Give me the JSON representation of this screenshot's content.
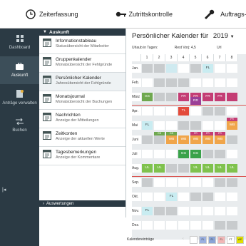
{
  "topbar": {
    "items": [
      {
        "label": "Zeiterfassung",
        "icon": "clock-icon"
      },
      {
        "label": "Zutrittskontrolle",
        "icon": "key-icon"
      },
      {
        "label": "Auftrags-/",
        "icon": "wrench-icon"
      }
    ]
  },
  "rail": {
    "items": [
      {
        "label": "Dashboard",
        "icon": "dashboard-icon"
      },
      {
        "label": "Auskunft",
        "icon": "briefcase-icon",
        "active": true
      },
      {
        "label": "Anträge verwalten",
        "icon": "document-icon"
      },
      {
        "label": "Buchen",
        "icon": "swap-icon"
      }
    ],
    "collapse_glyph": "|◂"
  },
  "menu": {
    "header": "Auskunft",
    "items": [
      {
        "title": "Informationstableau",
        "sub": "Statusübersicht der Mitarbeiter",
        "icon": "table-icon"
      },
      {
        "title": "Gruppenkalender",
        "sub": "Monatsübersicht der Fehlgründe",
        "icon": "calendar-grid-icon"
      },
      {
        "title": "Persönlicher Kalender",
        "sub": "Jahresübersicht der Fehlgründe",
        "icon": "calendar-year-icon",
        "selected": true
      },
      {
        "title": "Monatsjournal",
        "sub": "Monatsübersicht der Buchungen",
        "icon": "journal-icon"
      },
      {
        "title": "Nachrichten",
        "sub": "Anzeige der Mitteilungen",
        "icon": "message-icon"
      },
      {
        "title": "Zeitkonten",
        "sub": "Anzeige der aktuellen Werte",
        "icon": "clock-account-icon"
      },
      {
        "title": "Tagesbemerkungen",
        "sub": "Anzeige der Kommentare",
        "icon": "notes-icon"
      }
    ],
    "footer": "Auswertungen"
  },
  "calendar": {
    "title": "Persönlicher Kalender für",
    "year": "2019",
    "info_left": "Urlaub in Tagen:",
    "info_mid": "Rest Vorj: 4,5",
    "info_right": "Url",
    "days": [
      "1",
      "2",
      "3",
      "4",
      "5",
      "6",
      "7",
      "8"
    ],
    "months": [
      "Jan.",
      "Feb.",
      "März",
      "Apr.",
      "Mai",
      "Juni",
      "Juli",
      "Aug.",
      "Sep.",
      "Okt.",
      "Nov.",
      "Dez."
    ],
    "legend_label": "Kalendereinträge",
    "legend_swatches": [
      {
        "label": "",
        "color": "#ffffff"
      },
      {
        "label": "FL",
        "color": "#9bb0e0"
      },
      {
        "label": "FL",
        "color": "#8aa4d6"
      },
      {
        "label": "FL",
        "color": "#f2b7b7"
      },
      {
        "label": "FT",
        "color": "#ffffff"
      },
      {
        "label": "WE",
        "color": "#e0e000"
      }
    ],
    "cells": [
      {
        "m": 0,
        "d": 1,
        "t": "",
        "c": "#c8cbcd"
      },
      {
        "m": 0,
        "d": 2,
        "t": "",
        "c": "#c8cbcd"
      },
      {
        "m": 0,
        "d": 3,
        "t": "",
        "c": "#cfeaf0"
      },
      {
        "m": 0,
        "d": 6,
        "t": "FL",
        "c": "#c9ecf1"
      },
      {
        "m": 1,
        "d": 3,
        "t": "",
        "c": "#c8cbcd"
      },
      {
        "m": 1,
        "d": 4,
        "t": "",
        "c": "#c8cbcd"
      },
      {
        "m": 2,
        "d": 1,
        "t": "GS",
        "c": "#6fa84f"
      },
      {
        "m": 2,
        "d": 4,
        "t": "FR",
        "c": "#c43d74"
      },
      {
        "m": 2,
        "d": 5,
        "t": "FR",
        "c": "#c43d74"
      },
      {
        "m": 2,
        "d": 6,
        "t": "FR",
        "c": "#c43d74"
      },
      {
        "m": 2,
        "d": 7,
        "t": "FR",
        "c": "#c43d74"
      },
      {
        "m": 2,
        "d": 8,
        "t": "",
        "c": "#c43d74"
      },
      {
        "m": 2,
        "d": 5,
        "t": "RR",
        "c": "#9b3f97",
        "row2": true
      },
      {
        "m": 3,
        "d": 4,
        "t": "TL",
        "c": "#e34b3b"
      },
      {
        "m": 3,
        "d": 6,
        "t": "",
        "c": "#c8cbcd"
      },
      {
        "m": 4,
        "d": 1,
        "t": "FL",
        "c": "#c9ecf1"
      },
      {
        "m": 4,
        "d": 8,
        "t": "FR",
        "c": "#c43d74",
        "half": true
      },
      {
        "m": 4,
        "d": 8,
        "t": "WB",
        "c": "#f0a54a"
      },
      {
        "m": 5,
        "d": 2,
        "t": "GS",
        "c": "#6fa84f",
        "half": true
      },
      {
        "m": 5,
        "d": 3,
        "t": "GS",
        "c": "#6fa84f",
        "half": true
      },
      {
        "m": 5,
        "d": 5,
        "t": "FR",
        "c": "#c43d74",
        "half": true
      },
      {
        "m": 5,
        "d": 6,
        "t": "FR",
        "c": "#c43d74",
        "half": true
      },
      {
        "m": 5,
        "d": 7,
        "t": "FR",
        "c": "#c43d74",
        "half": true
      },
      {
        "m": 5,
        "d": 3,
        "t": "WB",
        "c": "#f0a54a"
      },
      {
        "m": 5,
        "d": 4,
        "t": "WB",
        "c": "#f0a54a"
      },
      {
        "m": 5,
        "d": 5,
        "t": "WB",
        "c": "#f0a54a"
      },
      {
        "m": 5,
        "d": 6,
        "t": "WB",
        "c": "#f0a54a"
      },
      {
        "m": 5,
        "d": 7,
        "t": "WB",
        "c": "#f0a54a"
      },
      {
        "m": 6,
        "d": 4,
        "t": "GG",
        "c": "#3aa24a"
      },
      {
        "m": 6,
        "d": 5,
        "t": "GG",
        "c": "#3aa24a"
      },
      {
        "m": 7,
        "d": 1,
        "t": "UL",
        "c": "#7fc24d"
      },
      {
        "m": 7,
        "d": 2,
        "t": "UL",
        "c": "#7fc24d"
      },
      {
        "m": 7,
        "d": 5,
        "t": "UL",
        "c": "#7fc24d"
      },
      {
        "m": 7,
        "d": 6,
        "t": "UL",
        "c": "#7fc24d"
      },
      {
        "m": 7,
        "d": 7,
        "t": "UL",
        "c": "#7fc24d"
      },
      {
        "m": 7,
        "d": 8,
        "t": "UL",
        "c": "#7fc24d"
      },
      {
        "m": 8,
        "d": 1,
        "t": "",
        "c": "#c8cbcd"
      },
      {
        "m": 8,
        "d": 7,
        "t": "",
        "c": "#c8cbcd"
      },
      {
        "m": 9,
        "d": 3,
        "t": "FL",
        "c": "#c9ecf1"
      },
      {
        "m": 9,
        "d": 5,
        "t": "",
        "c": "#c8cbcd"
      },
      {
        "m": 10,
        "d": 1,
        "t": "FL",
        "c": "#c9ecf1"
      },
      {
        "m": 10,
        "d": 2,
        "t": "",
        "c": "#c8cbcd"
      },
      {
        "m": 10,
        "d": 3,
        "t": "",
        "c": "#c8cbcd"
      },
      {
        "m": 11,
        "d": 7,
        "t": "",
        "c": "#c8cbcd"
      }
    ],
    "weekend_cols": [
      [
        5,
        6
      ],
      [
        2,
        3
      ],
      [
        2,
        3
      ],
      [
        6,
        7
      ],
      [
        4,
        5
      ],
      [
        1,
        2,
        8
      ],
      [
        6,
        7
      ],
      [
        3,
        4
      ],
      [
        7,
        8
      ],
      [
        5,
        6
      ],
      [
        2,
        3
      ],
      [
        7,
        8
      ]
    ]
  },
  "colors": {
    "rail_bg": "#2b3a44",
    "rail_active": "#3c4e59",
    "accent_red": "#d9534f"
  }
}
